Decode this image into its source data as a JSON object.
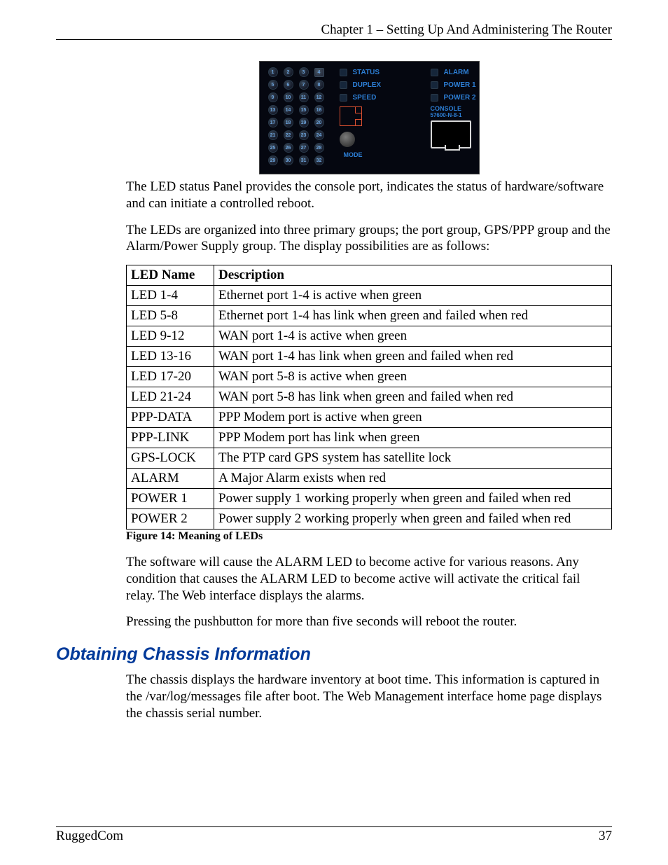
{
  "header": {
    "chapter": "Chapter 1 – Setting Up And Administering The Router"
  },
  "panel": {
    "led_numbers": [
      "1",
      "2",
      "3",
      "4",
      "5",
      "6",
      "7",
      "8",
      "9",
      "10",
      "11",
      "12",
      "13",
      "14",
      "15",
      "16",
      "17",
      "18",
      "19",
      "20",
      "21",
      "22",
      "23",
      "24",
      "25",
      "26",
      "27",
      "28",
      "29",
      "30",
      "31",
      "32"
    ],
    "mid_labels": {
      "status": "STATUS",
      "duplex": "DUPLEX",
      "speed": "SPEED",
      "mode": "MODE"
    },
    "right_labels": {
      "alarm": "ALARM",
      "power1": "POWER 1",
      "power2": "POWER 2",
      "console": "CONSOLE",
      "baud": "57600-N-8-1"
    }
  },
  "body": {
    "p1": "The LED status Panel provides the console port, indicates the status of hardware/software and can initiate a controlled reboot.",
    "p2": "The LEDs are organized into three primary groups; the port group, GPS/PPP group and the Alarm/Power Supply group.  The display possibilities are as follows:",
    "p3": "The software will cause the ALARM LED to become active for various reasons.  Any condition that causes the ALARM LED to become active will activate the critical fail relay.  The Web interface displays the alarms.",
    "p4": "Pressing the pushbutton for more than five seconds will reboot the router.",
    "p5": "The chassis displays the hardware inventory at boot time.  This information is captured in the /var/log/messages file after boot.  The Web Management interface home page displays the chassis serial number."
  },
  "table": {
    "headers": {
      "name": "LED Name",
      "desc": "Description"
    },
    "rows": [
      {
        "name": "LED 1-4",
        "desc": "Ethernet port 1-4 is active when green"
      },
      {
        "name": "LED 5-8",
        "desc": "Ethernet port 1-4 has link when green and failed when red"
      },
      {
        "name": "LED 9-12",
        "desc": "WAN port 1-4 is active when green"
      },
      {
        "name": "LED 13-16",
        "desc": "WAN port 1-4 has link when green and failed when red"
      },
      {
        "name": "LED 17-20",
        "desc": "WAN port 5-8 is active when green"
      },
      {
        "name": "LED 21-24",
        "desc": "WAN port 5-8 has link when green and failed when red"
      },
      {
        "name": "PPP-DATA",
        "desc": "PPP Modem port is active when green",
        "group": true
      },
      {
        "name": "PPP-LINK",
        "desc": "PPP Modem port has link when green"
      },
      {
        "name": "GPS-LOCK",
        "desc": "The PTP card GPS system has satellite lock"
      },
      {
        "name": "ALARM",
        "desc": "A Major Alarm exists when red",
        "group": true
      },
      {
        "name": "POWER 1",
        "desc": "Power supply 1 working properly when green and failed when red"
      },
      {
        "name": "POWER 2",
        "desc": "Power supply 2 working properly when green and failed when red"
      }
    ],
    "caption": "Figure 14: Meaning of LEDs"
  },
  "section": {
    "title": "Obtaining Chassis Information"
  },
  "footer": {
    "left": "RuggedCom",
    "right": "37"
  }
}
